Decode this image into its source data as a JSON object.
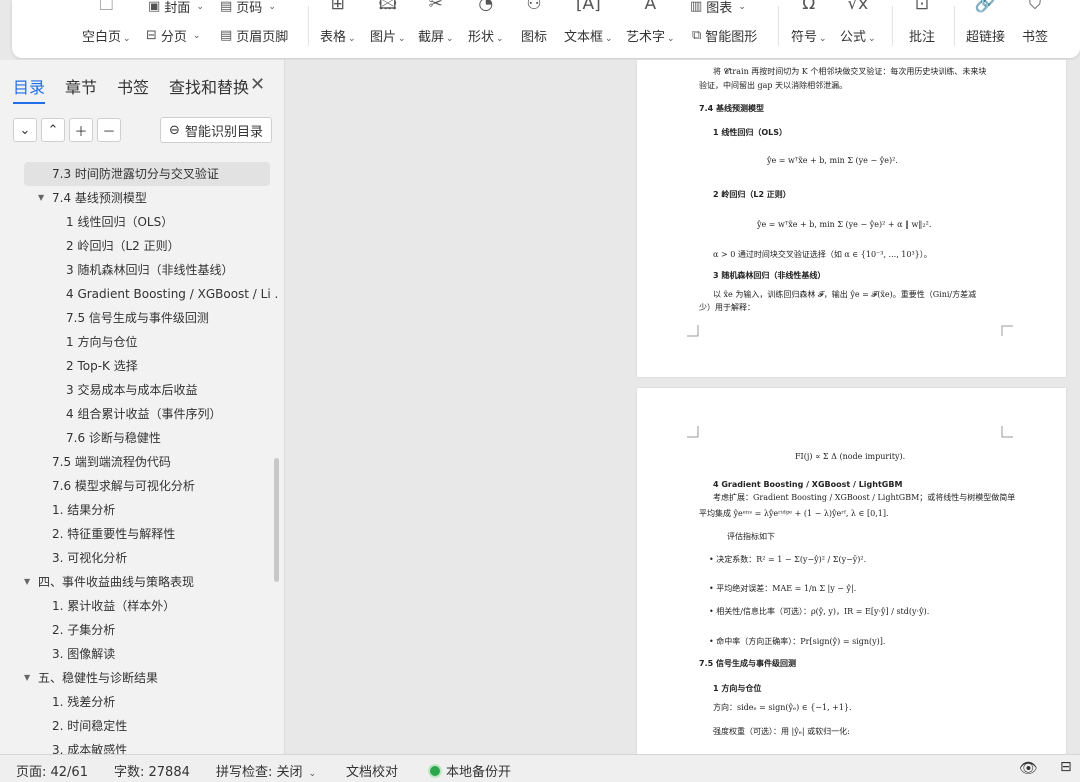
{
  "ribbon": {
    "top_small": {
      "cover": "封面",
      "pagenum": "页码",
      "chart": "图表"
    },
    "blank_page": "空白页",
    "section_break": "分页",
    "header_footer": "页眉页脚",
    "table": "表格",
    "picture": "图片",
    "screenshot": "截屏",
    "shape": "形状",
    "icon": "图标",
    "textbox": "文本框",
    "wordart": "艺术字",
    "smart_shape": "智能图形",
    "symbol": "符号",
    "formula": "公式",
    "comment": "批注",
    "hyperlink": "超链接",
    "bookmark": "书签"
  },
  "sidebar": {
    "tabs": [
      "目录",
      "章节",
      "书签",
      "查找和替换"
    ],
    "active_tab": 0,
    "smart_toc": "智能识别目录",
    "toc": [
      {
        "label": "7.3 时间防泄露切分与交叉验证",
        "level": 2,
        "selected": true
      },
      {
        "label": "7.4 基线预测模型",
        "level": 2,
        "expand": true
      },
      {
        "label": "1 线性回归（OLS）",
        "level": 3
      },
      {
        "label": "2 岭回归（L2 正则）",
        "level": 3
      },
      {
        "label": "3 随机森林回归（非线性基线）",
        "level": 3
      },
      {
        "label": "4 Gradient Boosting / XGBoost / Li ...",
        "level": 3
      },
      {
        "label": "7.5 信号生成与事件级回测",
        "level": 3
      },
      {
        "label": "1 方向与仓位",
        "level": 3
      },
      {
        "label": "2 Top-K 选择",
        "level": 3
      },
      {
        "label": "3 交易成本与成本后收益",
        "level": 3
      },
      {
        "label": "4 组合累计收益（事件序列）",
        "level": 3
      },
      {
        "label": "7.6 诊断与稳健性",
        "level": 3
      },
      {
        "label": "7.5 端到端流程伪代码",
        "level": 2
      },
      {
        "label": "7.6 模型求解与可视化分析",
        "level": 2
      },
      {
        "label": "1. 结果分析",
        "level": 2
      },
      {
        "label": "2. 特征重要性与解释性",
        "level": 2
      },
      {
        "label": "3. 可视化分析",
        "level": 2
      },
      {
        "label": "四、事件收益曲线与策略表现",
        "level": 1,
        "expand": true
      },
      {
        "label": "1. 累计收益（样本外）",
        "level": 2
      },
      {
        "label": "2. 子集分析",
        "level": 2
      },
      {
        "label": "3. 图像解读",
        "level": 2
      },
      {
        "label": "五、稳健性与诊断结果",
        "level": 1,
        "expand": true
      },
      {
        "label": "1. 残差分析",
        "level": 2
      },
      {
        "label": "2. 时间稳定性",
        "level": 2
      },
      {
        "label": "3. 成本敏感性",
        "level": 2
      }
    ]
  },
  "document": {
    "page1": [
      {
        "text": "将 𝓒train 再按时间切为 K 个相邻块做交叉验证：每次用历史块训练、未来块",
        "cls": ""
      },
      {
        "text": "验证，中间留出 gap 天以消除相邻泄漏。",
        "cls": ""
      },
      {
        "text": "7.4 基线预测模型",
        "cls": "b"
      },
      {
        "text": "1 线性回归（OLS）",
        "cls": "b"
      },
      {
        "text": "ŷe = wᵀx̃e + b,      min  Σ  (ye − ŷe)².",
        "cls": ""
      },
      {
        "text": "2 岭回归（L2 正则）",
        "cls": "b"
      },
      {
        "text": "ŷe = wᵀx̃e + b,      min  Σ (ye − ŷe)² + α ‖ w‖₂².",
        "cls": ""
      },
      {
        "text": "α > 0 通过时间块交叉验证选择（如 α ∈ {10⁻³, ..., 10³}）。",
        "cls": ""
      },
      {
        "text": "3 随机森林回归（非线性基线）",
        "cls": "b"
      },
      {
        "text": "以 x̃e 为输入，训练回归森林 𝓕，输出 ŷe = 𝓕(x̃e)。重要性（Gini/方差减",
        "cls": ""
      },
      {
        "text": "少）用于解释：",
        "cls": ""
      }
    ],
    "page2": [
      {
        "text": "FI(j) ∝   Σ   Δ (node impurity).",
        "cls": ""
      },
      {
        "text": "4 Gradient Boosting / XGBoost / LightGBM",
        "cls": "b"
      },
      {
        "text": "考虑扩展：Gradient Boosting / XGBoost / LightGBM；或将线性与树模型做简单",
        "cls": ""
      },
      {
        "text": "平均集成 ŷeᵉⁿˢ = λŷeʳⁱᵈᵍᵉ + (1 − λ)ŷeʳᶠ,  λ ∈ [0,1].",
        "cls": ""
      },
      {
        "text": "评估指标如下",
        "cls": ""
      },
      {
        "text": "•   决定系数：R² = 1 − Σ(y−ŷ)² / Σ(y−ȳ)².",
        "cls": ""
      },
      {
        "text": "•   平均绝对误差：MAE = 1/n Σ |y − ŷ|.",
        "cls": ""
      },
      {
        "text": "•   相关性/信息比率（可选）：ρ(ŷ, y)，IR = E[y·ŷ] / std(y·ŷ).",
        "cls": ""
      },
      {
        "text": "•   命中率（方向正确率）：Pr[sign(ŷ) = sign(y)].",
        "cls": ""
      },
      {
        "text": "7.5 信号生成与事件级回测",
        "cls": "b"
      },
      {
        "text": "1 方向与仓位",
        "cls": "b"
      },
      {
        "text": "方向：sideₑ = sign(ŷₑ) ∈ {−1, +1}.",
        "cls": ""
      },
      {
        "text": "强度权重（可选）：用 |ŷₑ| 或软归一化:",
        "cls": ""
      }
    ]
  },
  "status": {
    "page": "页面: 42/61",
    "words": "字数: 27884",
    "spell": "拼写检查: 关闭",
    "proof": "文档校对",
    "backup": "本地备份开"
  }
}
